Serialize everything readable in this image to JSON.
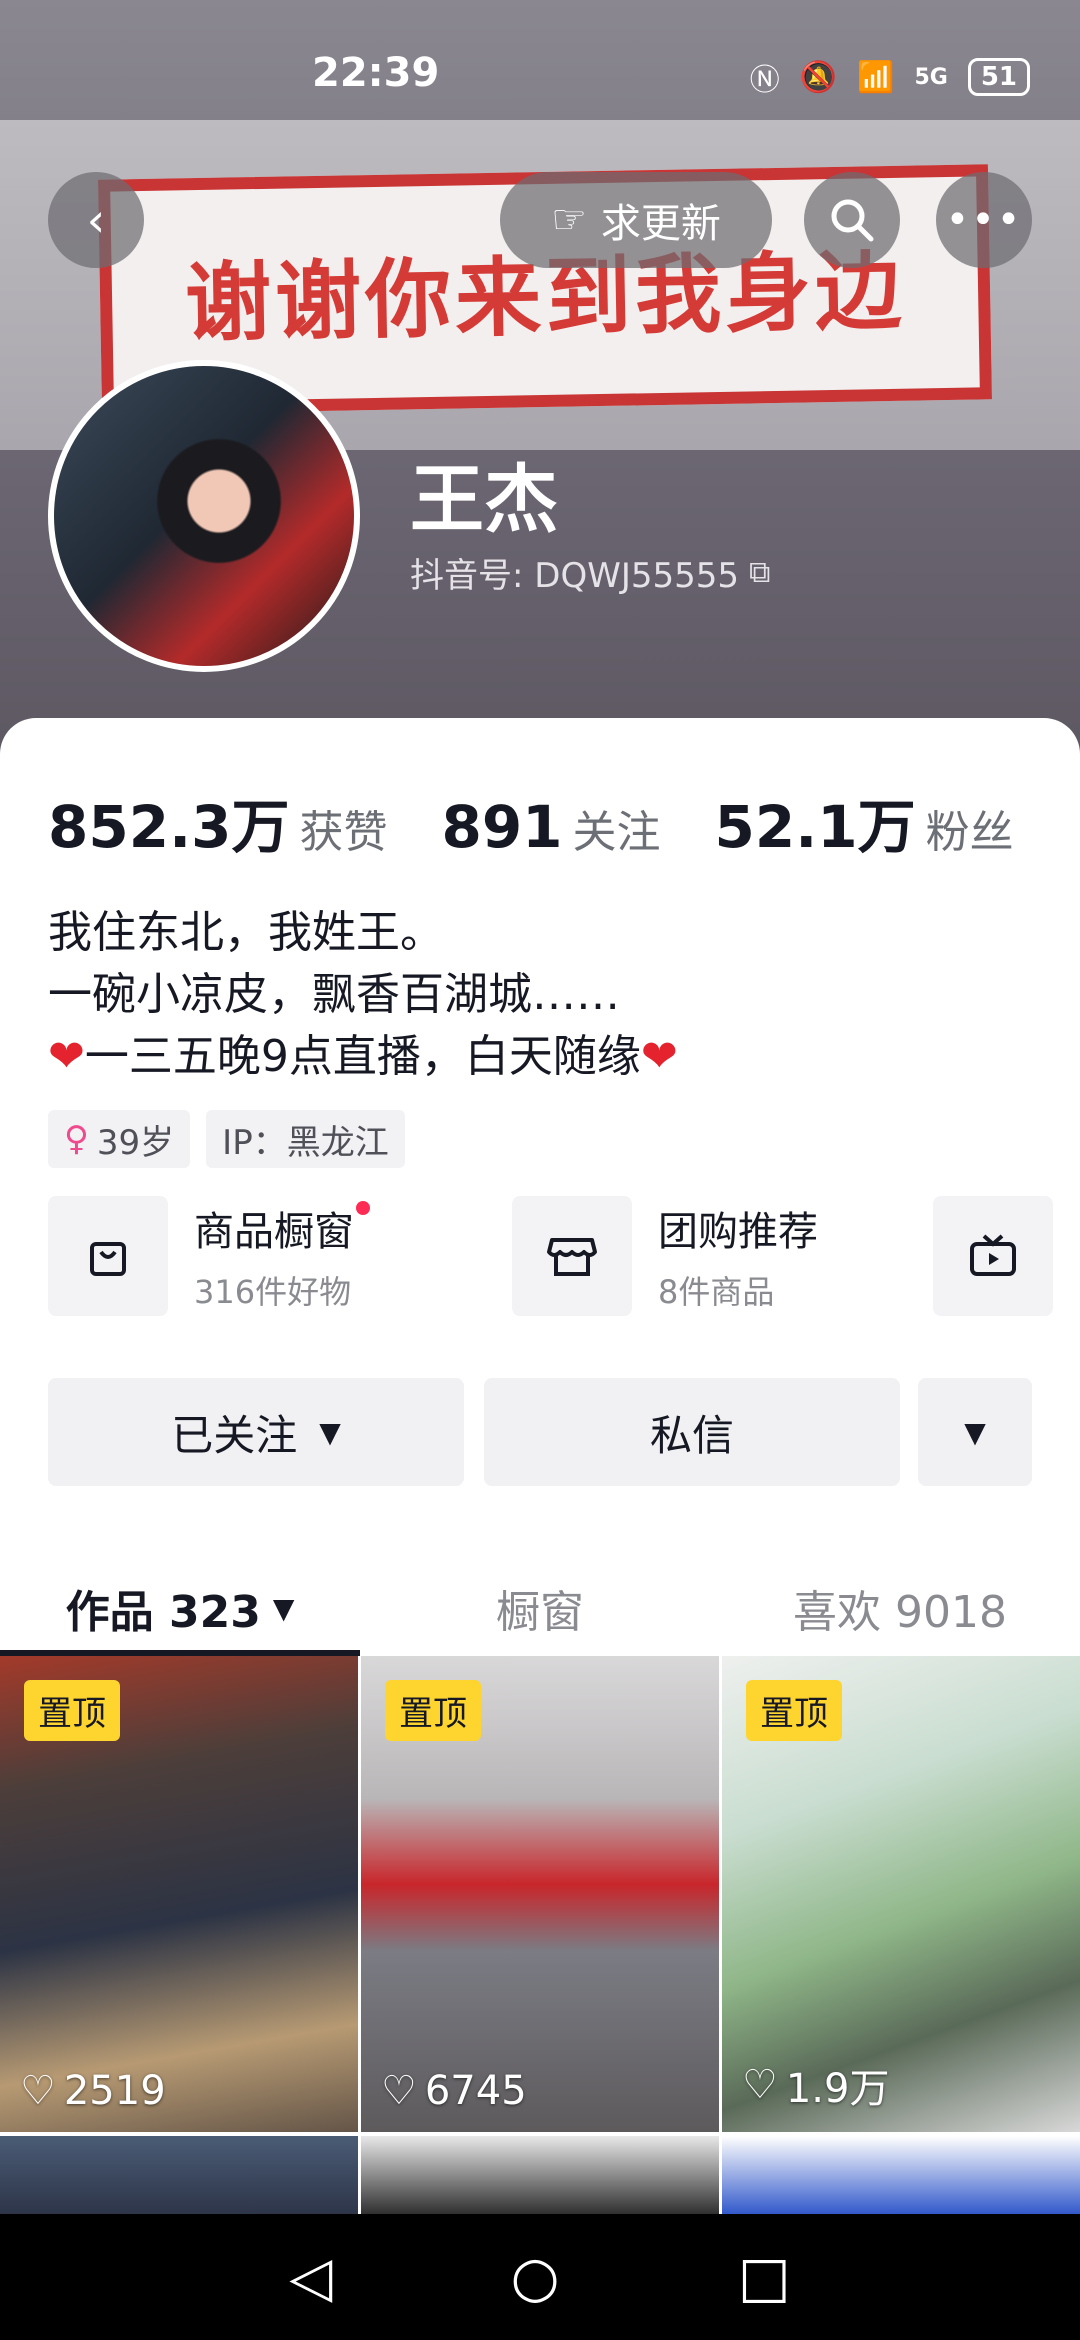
{
  "status_bar": {
    "time": "22:39",
    "network": "5G",
    "battery": "51"
  },
  "banner": {
    "sign_text": "谢谢你来到我身边"
  },
  "top_bar": {
    "update_label": "求更新"
  },
  "profile": {
    "name": "王杰",
    "douyin_id": "抖音号: DQWJ55555"
  },
  "stats": [
    {
      "value": "852.3万",
      "label": "获赞"
    },
    {
      "value": "891",
      "label": "关注"
    },
    {
      "value": "52.1万",
      "label": "粉丝"
    }
  ],
  "bio": [
    "我住东北，我姓王。",
    "一碗小凉皮，飘香百湖城……",
    "一三五晚9点直播，白天随缘"
  ],
  "tags": {
    "age": "39岁",
    "ip": "IP：黑龙江"
  },
  "shops": [
    {
      "title": "商品橱窗",
      "sub": "316件好物"
    },
    {
      "title": "团购推荐",
      "sub": "8件商品"
    }
  ],
  "actions": {
    "follow": "已关注",
    "message": "私信"
  },
  "tabs": [
    {
      "label": "作品 323"
    },
    {
      "label": "橱窗"
    },
    {
      "label": "喜欢 9018"
    }
  ],
  "videos": [
    {
      "pin": "置顶",
      "likes": "2519"
    },
    {
      "pin": "置顶",
      "likes": "6745"
    },
    {
      "pin": "置顶",
      "likes": "1.9万"
    }
  ]
}
